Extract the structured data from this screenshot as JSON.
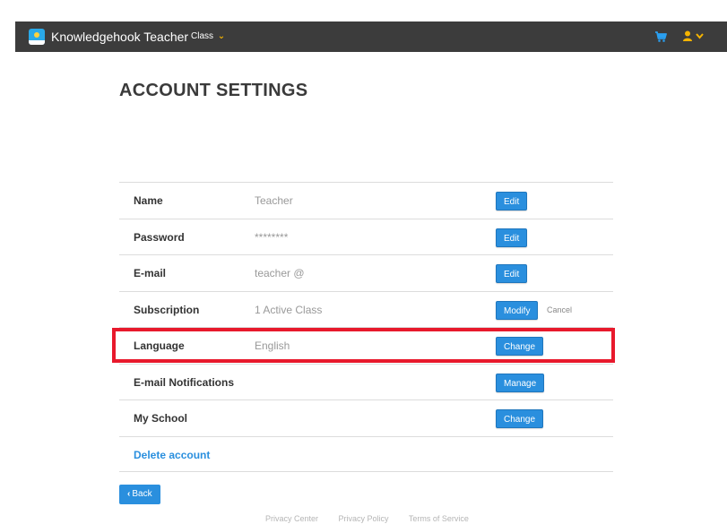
{
  "navbar": {
    "brand": "Knowledgehook Teacher",
    "class_menu_label": "Class"
  },
  "page": {
    "title": "ACCOUNT SETTINGS"
  },
  "settings": {
    "rows": [
      {
        "label": "Name",
        "value": "Teacher",
        "button": "Edit"
      },
      {
        "label": "Password",
        "value": "********",
        "button": "Edit"
      },
      {
        "label": "E-mail",
        "value": "teacher @",
        "button": "Edit"
      },
      {
        "label": "Subscription",
        "value": "1 Active Class",
        "button": "Modify",
        "secondary": "Cancel"
      },
      {
        "label": "Language",
        "value": "English",
        "button": "Change"
      },
      {
        "label": "E-mail Notifications",
        "value": "",
        "button": "Manage"
      },
      {
        "label": "My School",
        "value": "",
        "button": "Change"
      }
    ],
    "delete_label": "Delete account"
  },
  "back_label": "Back",
  "footer": {
    "links": [
      "Privacy Center",
      "Privacy Policy",
      "Terms of Service"
    ]
  },
  "colors": {
    "navbar_bg": "#3c3c3c",
    "accent": "#2a8fde",
    "highlight": "#e8192c",
    "chevron": "#f5b400"
  },
  "icons": [
    "logo-icon",
    "chevron-down-icon",
    "cart-icon",
    "user-icon",
    "chevron-left-icon"
  ]
}
